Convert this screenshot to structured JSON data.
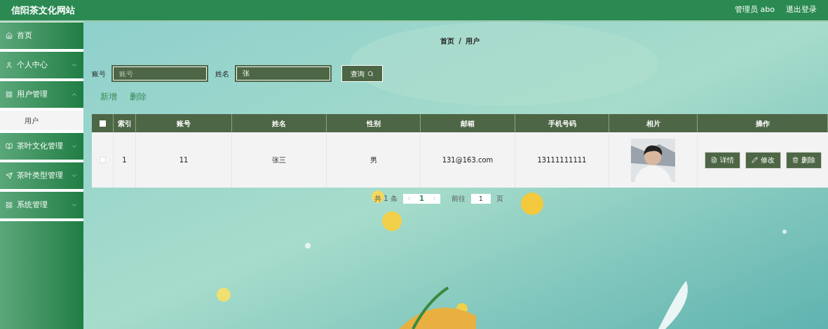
{
  "header": {
    "title": "信阳茶文化网站",
    "user": "管理员 abo",
    "logout": "退出登录"
  },
  "sidebar": {
    "items": [
      {
        "label": "首页"
      },
      {
        "label": "个人中心",
        "expanded": false
      },
      {
        "label": "用户管理",
        "expanded": true,
        "children": [
          {
            "label": "用户",
            "selected": true
          }
        ]
      },
      {
        "label": "茶叶文化管理",
        "expanded": false
      },
      {
        "label": "茶叶类型管理",
        "expanded": false
      },
      {
        "label": "系统管理",
        "expanded": false
      }
    ]
  },
  "breadcrumb": [
    "首页",
    "用户"
  ],
  "breadcrumb_separator": "/",
  "search": {
    "fields": [
      {
        "label": "账号",
        "placeholder": "账号"
      },
      {
        "label": "姓名",
        "value": "张"
      }
    ],
    "button": "查询"
  },
  "actions": [
    "新增",
    "删除"
  ],
  "table": {
    "columns": [
      "索引",
      "账号",
      "姓名",
      "性别",
      "邮箱",
      "手机号码",
      "相片",
      "操作"
    ],
    "header_checked": false,
    "rows": [
      {
        "checked": false,
        "cells": [
          "1",
          "11",
          "张三",
          "男",
          "131@163.com",
          "13111111111"
        ],
        "buttons": [
          {
            "kind": "detail",
            "label": "详情"
          },
          {
            "kind": "edit",
            "label": "修改"
          },
          {
            "kind": "delete",
            "label": "删除"
          }
        ]
      }
    ]
  },
  "pagination": {
    "total": "共 1 条",
    "page": "1",
    "goto_prefix": "前往",
    "goto_value": "1",
    "goto_suffix": "页"
  }
}
